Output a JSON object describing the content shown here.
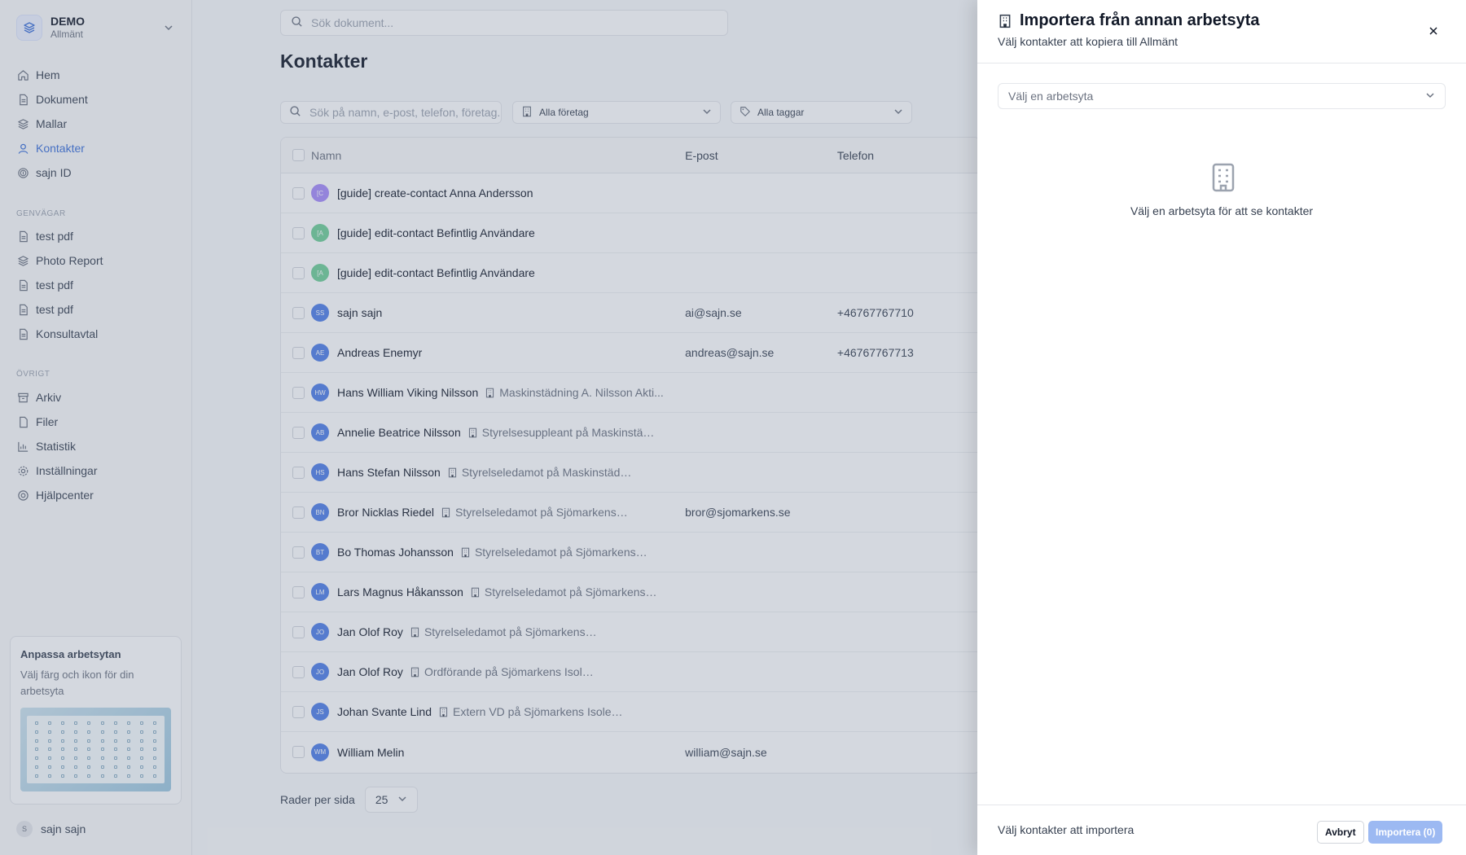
{
  "sidebar": {
    "workspace": {
      "name": "DEMO",
      "subtitle": "Allmänt"
    },
    "main_nav": [
      {
        "label": "Hem",
        "icon": "home-icon",
        "active": false
      },
      {
        "label": "Dokument",
        "icon": "document-icon",
        "active": false
      },
      {
        "label": "Mallar",
        "icon": "layers-icon",
        "active": false
      },
      {
        "label": "Kontakter",
        "icon": "user-icon",
        "active": true
      },
      {
        "label": "sajn ID",
        "icon": "fingerprint-icon",
        "active": false
      }
    ],
    "shortcuts_title": "GENVÄGAR",
    "shortcuts": [
      {
        "label": "test pdf",
        "icon": "document-icon"
      },
      {
        "label": "Photo Report",
        "icon": "layers-icon"
      },
      {
        "label": "test pdf",
        "icon": "document-icon"
      },
      {
        "label": "test pdf",
        "icon": "document-icon"
      },
      {
        "label": "Konsultavtal",
        "icon": "document-icon"
      }
    ],
    "other_title": "ÖVRIGT",
    "other": [
      {
        "label": "Arkiv",
        "icon": "archive-icon"
      },
      {
        "label": "Filer",
        "icon": "file-icon"
      },
      {
        "label": "Statistik",
        "icon": "chart-icon"
      },
      {
        "label": "Inställningar",
        "icon": "gear-icon"
      },
      {
        "label": "Hjälpcenter",
        "icon": "help-icon"
      }
    ],
    "promo": {
      "title": "Anpassa arbetsytan",
      "text": "Välj färg och ikon för din arbetsyta"
    },
    "user": {
      "initial": "S",
      "name": "sajn sajn"
    }
  },
  "main": {
    "search_placeholder": "Sök dokument...",
    "title": "Kontakter",
    "filter_search_placeholder": "Sök på namn, e-post, telefon, företag...",
    "company_filter": "Alla företag",
    "tag_filter": "Alla taggar",
    "columns": {
      "name": "Namn",
      "email": "E-post",
      "phone": "Telefon"
    },
    "rows": [
      {
        "initials": "[C",
        "color": "#a78bfa",
        "name": "[guide] create-contact Anna Andersson",
        "role": "",
        "email": "",
        "phone": ""
      },
      {
        "initials": "[A",
        "color": "#6fcf97",
        "name": "[guide] edit-contact Befintlig Användare",
        "role": "",
        "email": "",
        "phone": ""
      },
      {
        "initials": "[A",
        "color": "#6fcf97",
        "name": "[guide] edit-contact Befintlig Användare",
        "role": "",
        "email": "",
        "phone": ""
      },
      {
        "initials": "SS",
        "color": "#4f7fe8",
        "name": "sajn sajn",
        "role": "",
        "email": "ai@sajn.se",
        "phone": "+46767767710"
      },
      {
        "initials": "AE",
        "color": "#4f7fe8",
        "name": "Andreas Enemyr",
        "role": "",
        "email": "andreas@sajn.se",
        "phone": "+46767767713"
      },
      {
        "initials": "HW",
        "color": "#4f7fe8",
        "name": "Hans William Viking Nilsson",
        "role": "Maskinstädning A. Nilsson Akti...",
        "email": "",
        "phone": ""
      },
      {
        "initials": "AB",
        "color": "#4f7fe8",
        "name": "Annelie Beatrice Nilsson",
        "role": "Styrelsesuppleant på Maskinstädni...",
        "email": "",
        "phone": ""
      },
      {
        "initials": "HS",
        "color": "#4f7fe8",
        "name": "Hans Stefan Nilsson",
        "role": "Styrelseledamot på Maskinstädning A. ...",
        "email": "",
        "phone": ""
      },
      {
        "initials": "BN",
        "color": "#4f7fe8",
        "name": "Bror Nicklas Riedel",
        "role": "Styrelseledamot på Sjömarkens Isolerin...",
        "email": "bror@sjomarkens.se",
        "phone": ""
      },
      {
        "initials": "BT",
        "color": "#4f7fe8",
        "name": "Bo Thomas Johansson",
        "role": "Styrelseledamot på Sjömarkens Isol...",
        "email": "",
        "phone": ""
      },
      {
        "initials": "LM",
        "color": "#4f7fe8",
        "name": "Lars Magnus Håkansson",
        "role": "Styrelseledamot på Sjömarkens Is...",
        "email": "",
        "phone": ""
      },
      {
        "initials": "JO",
        "color": "#4f7fe8",
        "name": "Jan Olof Roy",
        "role": "Styrelseledamot på Sjömarkens Isolering Aktie...",
        "email": "",
        "phone": ""
      },
      {
        "initials": "JO",
        "color": "#4f7fe8",
        "name": "Jan Olof Roy",
        "role": "Ordförande på Sjömarkens Isolering Aktiebolag",
        "email": "",
        "phone": ""
      },
      {
        "initials": "JS",
        "color": "#4f7fe8",
        "name": "Johan Svante Lind",
        "role": "Extern VD på Sjömarkens Isolering Aktie...",
        "email": "",
        "phone": ""
      },
      {
        "initials": "WM",
        "color": "#4f7fe8",
        "name": "William Melin",
        "role": "",
        "email": "william@sajn.se",
        "phone": ""
      }
    ],
    "pager_label": "Rader per sida",
    "pager_value": "25"
  },
  "panel": {
    "title": "Importera från annan arbetsyta",
    "subtitle": "Välj kontakter att kopiera till Allmänt",
    "workspace_placeholder": "Välj en arbetsyta",
    "empty_text": "Välj en arbetsyta för att se kontakter",
    "footer_text": "Välj kontakter att importera",
    "cancel_label": "Avbryt",
    "import_label": "Importera (0)"
  },
  "colors": {
    "accent": "#3b6fd8",
    "import_disabled": "#9cb9f2",
    "overlay": "#64748b"
  }
}
